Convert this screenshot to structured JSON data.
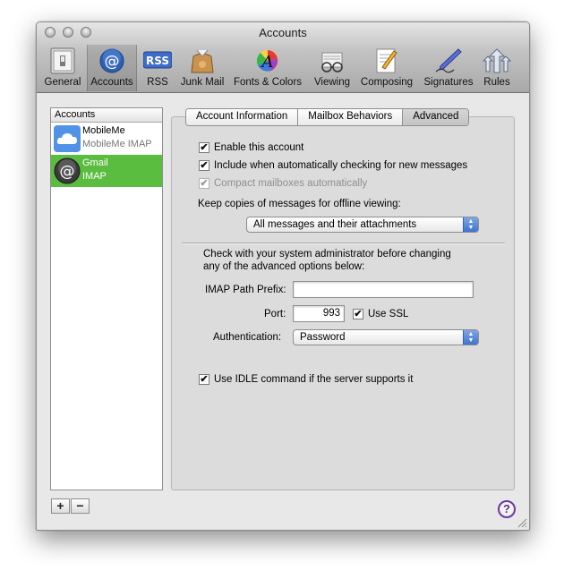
{
  "window": {
    "title": "Accounts"
  },
  "toolbar": {
    "items": [
      {
        "label": "General",
        "icon": "general-switch-icon"
      },
      {
        "label": "Accounts",
        "icon": "at-sign-icon"
      },
      {
        "label": "RSS",
        "icon": "rss-icon"
      },
      {
        "label": "Junk Mail",
        "icon": "junk-mail-bag-icon"
      },
      {
        "label": "Fonts & Colors",
        "icon": "fonts-colors-icon"
      },
      {
        "label": "Viewing",
        "icon": "viewing-glasses-icon"
      },
      {
        "label": "Composing",
        "icon": "composing-pencil-icon"
      },
      {
        "label": "Signatures",
        "icon": "signatures-pen-icon"
      },
      {
        "label": "Rules",
        "icon": "rules-arrows-icon"
      }
    ],
    "selected": "Accounts",
    "rss_icon_text": "RSS"
  },
  "sidebar": {
    "header": "Accounts",
    "accounts": [
      {
        "name": "MobileMe",
        "type": "MobileMe IMAP",
        "icon": "cloud-icon",
        "selected": false
      },
      {
        "name": "Gmail",
        "type": "IMAP",
        "icon": "at-sign-icon",
        "selected": true
      }
    ],
    "add_label": "+",
    "remove_label": "−"
  },
  "tabs": [
    {
      "label": "Account Information",
      "active": false
    },
    {
      "label": "Mailbox Behaviors",
      "active": false
    },
    {
      "label": "Advanced",
      "active": true
    }
  ],
  "advanced": {
    "enable_account": {
      "label": "Enable this account",
      "checked": true
    },
    "include_checking": {
      "label": "Include when automatically checking for new messages",
      "checked": true
    },
    "compact_mailboxes": {
      "label": "Compact mailboxes automatically",
      "checked": true,
      "disabled": true
    },
    "offline_label": "Keep copies of messages for offline viewing:",
    "offline_value": "All messages and their attachments",
    "admin_note_line1": "Check with your system administrator before changing",
    "admin_note_line2": "any of the advanced options below:",
    "imap_prefix_label": "IMAP Path Prefix:",
    "imap_prefix_value": "",
    "port_label": "Port:",
    "port_value": "993",
    "use_ssl": {
      "label": "Use SSL",
      "checked": true
    },
    "auth_label": "Authentication:",
    "auth_value": "Password",
    "use_idle": {
      "label": "Use IDLE command if the server supports it",
      "checked": true
    }
  },
  "help_label": "?",
  "checkmark": "✔",
  "colors": {
    "selection_green": "#5bbd3f",
    "help_purple": "#6b3aa0",
    "select_blue": "#3c73d3"
  }
}
